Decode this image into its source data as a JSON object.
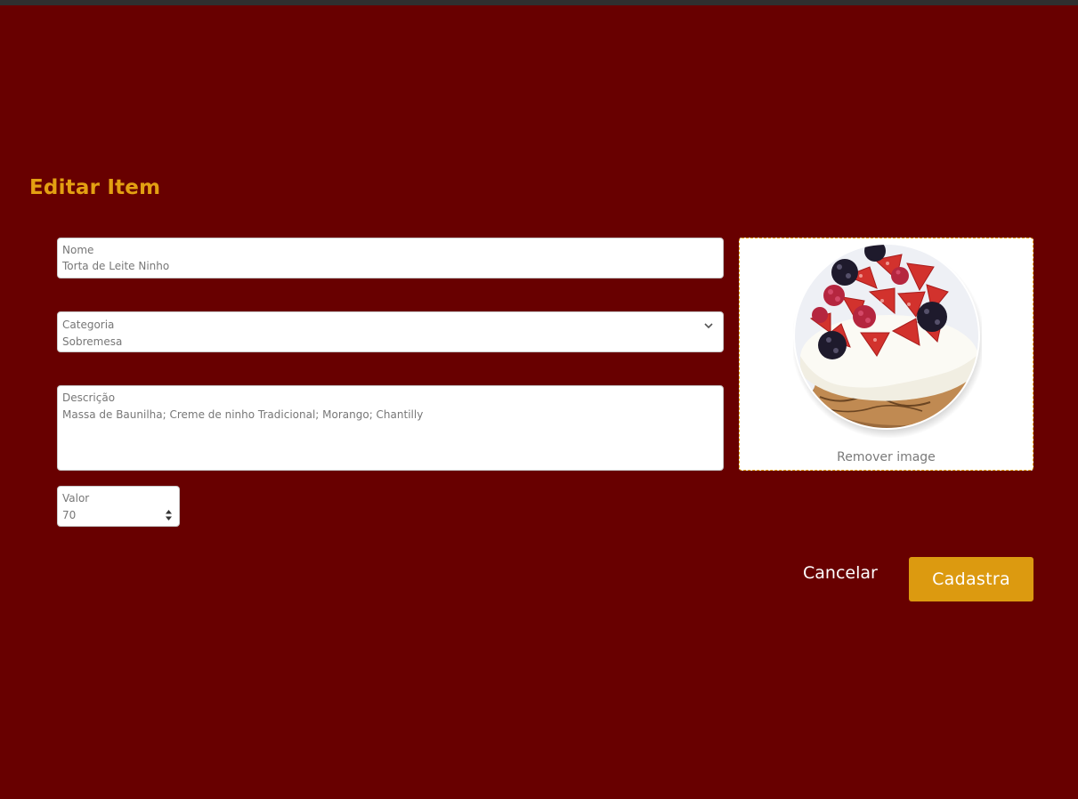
{
  "page": {
    "title": "Editar Item"
  },
  "form": {
    "nome": {
      "label": "Nome",
      "value": "Torta de Leite Ninho"
    },
    "categoria": {
      "label": "Categoria",
      "value": "Sobremesa"
    },
    "descricao": {
      "label": "Descrição",
      "value": "Massa de Baunilha; Creme de ninho Tradicional; Morango; Chantilly"
    },
    "valor": {
      "label": "Valor",
      "value": "70"
    }
  },
  "image": {
    "remove_label": "Remover image",
    "icon": "dish-photo"
  },
  "actions": {
    "cancel_label": "Cancelar",
    "submit_label": "Cadastra"
  },
  "colors": {
    "background": "#680000",
    "accent": "#e3a012",
    "button": "#dc9a10"
  }
}
